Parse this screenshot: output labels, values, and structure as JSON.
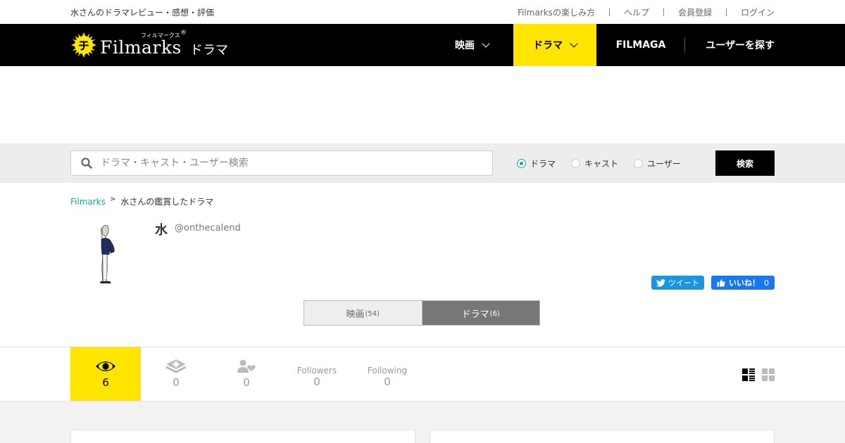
{
  "topbar": {
    "site_title": "水さんのドラマレビュー・感想・評価",
    "links": [
      "Filmarksの楽しみ方",
      "ヘルプ",
      "会員登録",
      "ログイン"
    ]
  },
  "header": {
    "logo_name": "Filmarks",
    "logo_kana": "フィルマークス",
    "logo_reg": "®",
    "section": "ドラマ",
    "nav": {
      "movie": "映画",
      "drama": "ドラマ",
      "filmaga": "FILMAGA",
      "users": "ユーザーを探す"
    }
  },
  "search": {
    "placeholder": "ドラマ・キャスト・ユーザー検索",
    "value": "",
    "options": [
      "ドラマ",
      "キャスト",
      "ユーザー"
    ],
    "selected": "ドラマ",
    "button": "検索"
  },
  "breadcrumb": {
    "home": "Filmarks",
    "arrow": ">",
    "current": "水さんの鑑賞したドラマ"
  },
  "profile": {
    "name": "水",
    "handle": "@onthecalend",
    "tweet": "ツイート",
    "like": "いいね！",
    "like_count": "0"
  },
  "tabs": {
    "movie_label": "映画",
    "movie_count": "(54)",
    "drama_label": "ドラマ",
    "drama_count": "(6)"
  },
  "stats": {
    "watched": "6",
    "wanted": "0",
    "fans": "0",
    "followers_label": "Followers",
    "followers": "0",
    "following_label": "Following",
    "following": "0"
  },
  "colors": {
    "accent": "#ffe500",
    "link": "#2aa198",
    "header_bg": "#000000",
    "twitter": "#1b95e0",
    "facebook": "#1877f2"
  }
}
